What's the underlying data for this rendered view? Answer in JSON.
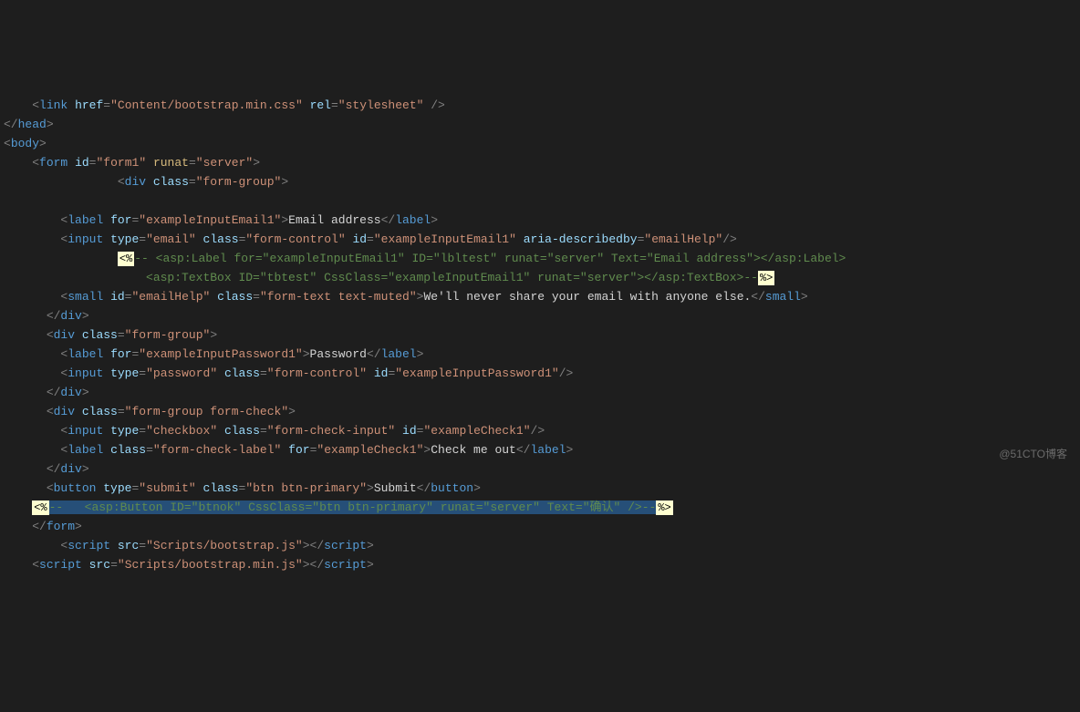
{
  "watermark": "@51CTO博客",
  "markers": {
    "open": "<%",
    "close": "%>"
  },
  "lines": {
    "l1": {
      "ind": "    ",
      "tag": "link",
      "a1": "href",
      "v1": "Content/bootstrap.min.css",
      "a2": "rel",
      "v2": "stylesheet"
    },
    "l2": {
      "ind": "",
      "tag": "head"
    },
    "l3": {
      "ind": "",
      "tag": "body"
    },
    "l4": {
      "ind": "    ",
      "tag": "form",
      "a1": "id",
      "v1": "form1",
      "a2": "runat",
      "v2": "server"
    },
    "l5": {
      "ind": "                ",
      "tag": "div",
      "a1": "class",
      "v1": "form-group"
    },
    "l7": {
      "ind": "        ",
      "tag": "label",
      "a1": "for",
      "v1": "exampleInputEmail1",
      "text": "Email address"
    },
    "l8": {
      "ind": "        ",
      "tag": "input",
      "a1": "type",
      "v1": "email",
      "a2": "class",
      "v2": "form-control",
      "a3": "id",
      "v3": "exampleInputEmail1",
      "a4": "aria-describedby",
      "v4": "emailHelp"
    },
    "l9": {
      "ind": "                ",
      "comment": "-- <asp:Label for=\"exampleInputEmail1\" ID=\"lbltest\" runat=\"server\" Text=\"Email address\"></asp:Label>"
    },
    "l10": {
      "ind": "                    ",
      "commentStart": "<asp:TextBox ID=\"tbtest\" CssClass=\"exampleInputEmail1\" runat=\"server\"></asp:TextBox>",
      "commentEnd": "--"
    },
    "l11": {
      "ind": "        ",
      "tag": "small",
      "a1": "id",
      "v1": "emailHelp",
      "a2": "class",
      "v2": "form-text text-muted",
      "text": "We'll never share your email with anyone else."
    },
    "l12": {
      "ind": "      ",
      "tag": "div"
    },
    "l13": {
      "ind": "      ",
      "tag": "div",
      "a1": "class",
      "v1": "form-group"
    },
    "l14": {
      "ind": "        ",
      "tag": "label",
      "a1": "for",
      "v1": "exampleInputPassword1",
      "text": "Password"
    },
    "l15": {
      "ind": "        ",
      "tag": "input",
      "a1": "type",
      "v1": "password",
      "a2": "class",
      "v2": "form-control",
      "a3": "id",
      "v3": "exampleInputPassword1"
    },
    "l16": {
      "ind": "      ",
      "tag": "div"
    },
    "l17": {
      "ind": "      ",
      "tag": "div",
      "a1": "class",
      "v1": "form-group form-check"
    },
    "l18": {
      "ind": "        ",
      "tag": "input",
      "a1": "type",
      "v1": "checkbox",
      "a2": "class",
      "v2": "form-check-input",
      "a3": "id",
      "v3": "exampleCheck1"
    },
    "l19": {
      "ind": "        ",
      "tag": "label",
      "a1": "class",
      "v1": "form-check-label",
      "a2": "for",
      "v2": "exampleCheck1",
      "text": "Check me out"
    },
    "l20": {
      "ind": "      ",
      "tag": "div"
    },
    "l21": {
      "ind": "      ",
      "tag": "button",
      "a1": "type",
      "v1": "submit",
      "a2": "class",
      "v2": "btn btn-primary",
      "text": "Submit"
    },
    "l22": {
      "ind": "    ",
      "dash": "--   ",
      "comment": "<asp:Button ID=\"btnok\" CssClass=\"btn btn-primary\" runat=\"server\" Text=\"确认\" />",
      "end": "--"
    },
    "l23": {
      "ind": "    ",
      "tag": "form"
    },
    "l24": {
      "ind": "        ",
      "tag": "script",
      "a1": "src",
      "v1": "Scripts/bootstrap.js"
    },
    "l25": {
      "ind": "    ",
      "tag": "script",
      "a1": "src",
      "v1": "Scripts/bootstrap.min.js"
    }
  }
}
